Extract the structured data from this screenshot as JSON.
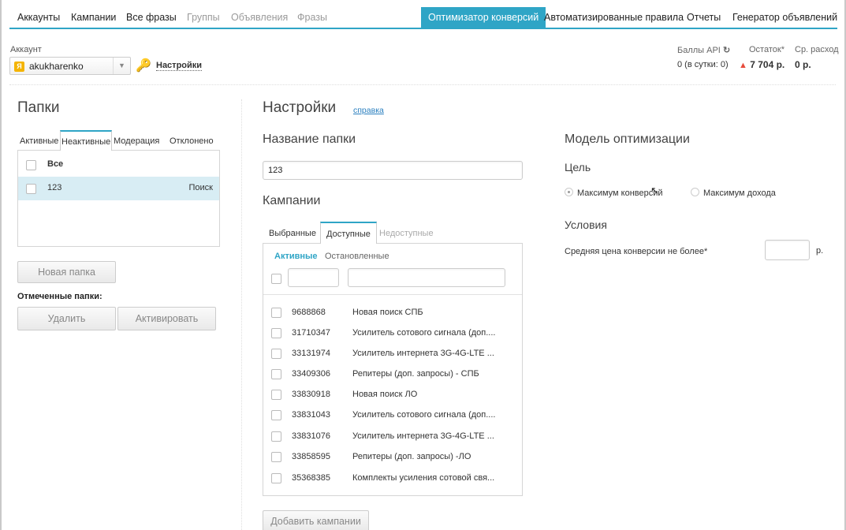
{
  "nav": {
    "items": [
      {
        "label": "Аккаунты",
        "state": "normal"
      },
      {
        "label": "Кампании",
        "state": "normal"
      },
      {
        "label": "Все фразы",
        "state": "normal"
      },
      {
        "label": "Группы",
        "state": "disabled"
      },
      {
        "label": "Объявления",
        "state": "disabled"
      },
      {
        "label": "Фразы",
        "state": "disabled"
      },
      {
        "label": "Оптимизатор конверсий",
        "state": "active"
      },
      {
        "label": "Автоматизированные правила",
        "state": "normal"
      },
      {
        "label": "Отчеты",
        "state": "normal"
      },
      {
        "label": "Генератор объявлений",
        "state": "normal"
      }
    ]
  },
  "account": {
    "label": "Аккаунт",
    "badge": "Я",
    "name": "akukharenko",
    "settings_link": "Настройки"
  },
  "stats": {
    "api_points_label": "Баллы API",
    "api_points_value": "0 (в сутки: 0)",
    "balance_label": "Остаток*",
    "balance_value": "7 704 р.",
    "avg_spend_label": "Ср. расход",
    "avg_spend_value": "0 р."
  },
  "folders": {
    "title": "Папки",
    "tabs": [
      "Активные",
      "Неактивные",
      "Модерация",
      "Отклонено"
    ],
    "active_tab": "Неактивные",
    "all_label": "Все",
    "rows": [
      {
        "name": "123",
        "type": "Поиск",
        "selected": true
      }
    ],
    "new_folder_button": "Новая папка",
    "marked_label": "Отмеченные папки:",
    "delete_button": "Удалить",
    "activate_button": "Активировать"
  },
  "settings": {
    "title": "Настройки",
    "help_link": "справка",
    "folder_name_label": "Название папки",
    "folder_name_value": "123",
    "campaigns_label": "Кампании",
    "campaign_tabs": [
      "Выбранные",
      "Доступные",
      "Недоступные"
    ],
    "active_campaign_tab": "Доступные",
    "subtabs": [
      "Активные",
      "Остановленные"
    ],
    "active_subtab": "Активные",
    "id_filter_value": "",
    "name_filter_value": "",
    "campaigns": [
      {
        "id": "9688868",
        "name": "Новая поиск СПБ"
      },
      {
        "id": "31710347",
        "name": "Усилитель сотового сигнала (доп...."
      },
      {
        "id": "33131974",
        "name": "Усилитель интернета 3G-4G-LTE ..."
      },
      {
        "id": "33409306",
        "name": "Репитеры (доп. запросы) - СПБ"
      },
      {
        "id": "33830918",
        "name": "Новая поиск ЛО"
      },
      {
        "id": "33831043",
        "name": "Усилитель сотового сигнала (доп...."
      },
      {
        "id": "33831076",
        "name": "Усилитель интернета 3G-4G-LTE ..."
      },
      {
        "id": "33858595",
        "name": "Репитеры (доп. запросы) -ЛО"
      },
      {
        "id": "35368385",
        "name": "Комплекты усиления сотовой свя..."
      }
    ],
    "add_campaigns_button": "Добавить кампании"
  },
  "optimization": {
    "title": "Модель оптимизации",
    "goal_label": "Цель",
    "goal_options": [
      "Максимум конверсий",
      "Максимум дохода"
    ],
    "selected_goal": "Максимум конверсий",
    "conditions_label": "Условия",
    "avg_price_label": "Средняя цена конверсии не более*",
    "avg_price_value": "",
    "currency": "р."
  },
  "colors": {
    "accent": "#2fa5c6",
    "selected_row": "#d8edf4",
    "warning": "#e74c3c"
  }
}
